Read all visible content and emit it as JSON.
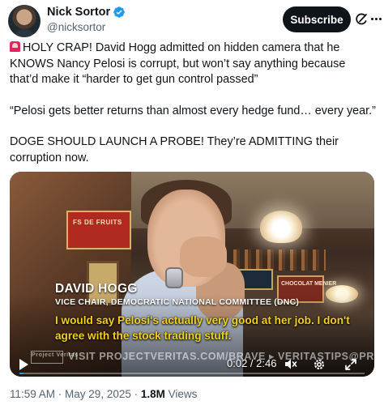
{
  "author": {
    "display_name": "Nick Sortor",
    "handle": "@nicksortor",
    "verified_color": "#1d9bf0"
  },
  "actions": {
    "subscribe_label": "Subscribe"
  },
  "tweet": {
    "paragraph_1": "HOLY CRAP! David Hogg admitted on hidden camera that he KNOWS Nancy Pelosi is corrupt, but won’t say anything because that’d make it “harder to get gun control passed”",
    "paragraph_2": "“Pelosi gets better returns than almost every hedge fund… every year.”",
    "paragraph_3": "DOGE SHOULD LAUNCH A PROBE! They’re ADMITTING their corruption now.",
    "leading_emoji": "siren-icon"
  },
  "video": {
    "caption_name": "DAVID HOGG",
    "caption_title": "VICE CHAIR, DEMOCRATIC NATIONAL COMMITTEE (DNC)",
    "caption_quote": "I would say Pelosi's actually very good at her job. I don't agree with the stock trading stuff.",
    "watermark_text": "VISIT PROJECTVERITAS.COM/BRAVE  ▸ VERITASTIPS@PROTONMAIL.COM",
    "watermark_logo": "Project Veritas",
    "sign_left": "FS DE FRUITS",
    "sign_right": "CHOCOLAT MENIER",
    "current_time": "0:02",
    "duration": "2:46",
    "progress_fraction": 0.012,
    "accent_color": "#1d9bf0"
  },
  "meta": {
    "time": "11:59 AM",
    "date": "May 29, 2025",
    "views_count": "1.8M",
    "views_label": "Views"
  }
}
